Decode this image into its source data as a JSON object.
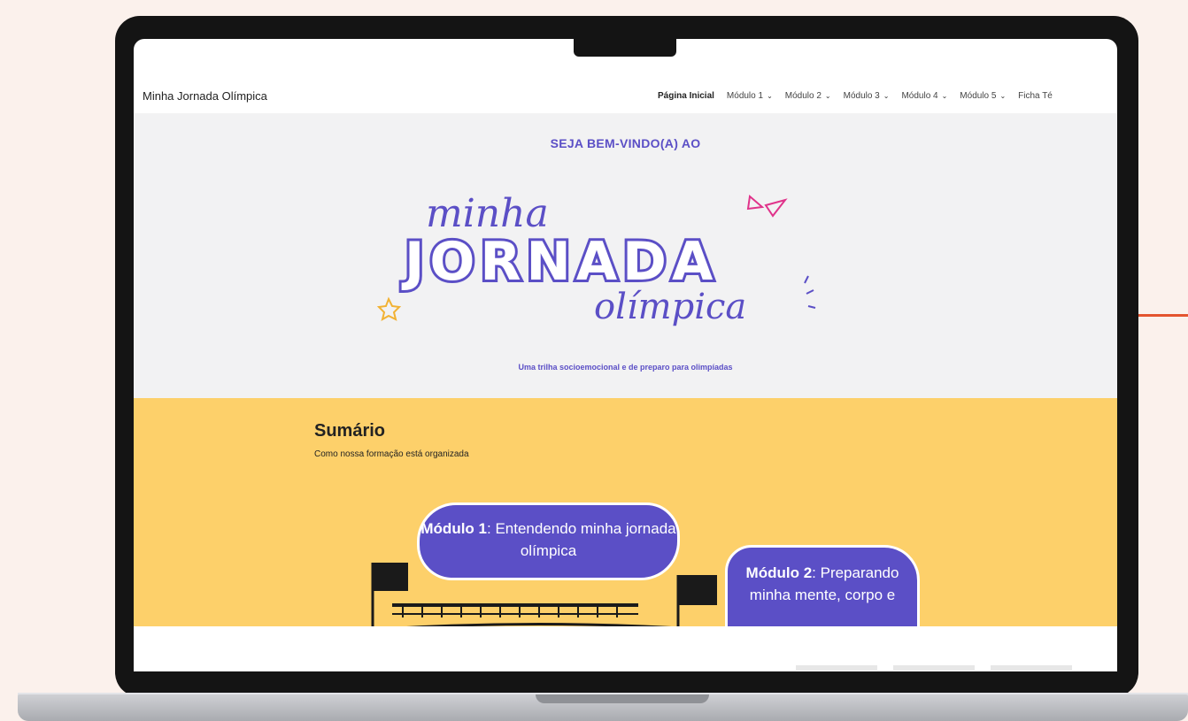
{
  "site": {
    "title": "Minha Jornada Olímpica"
  },
  "nav": {
    "items": [
      {
        "label": "Página Inicial",
        "active": true,
        "dropdown": false
      },
      {
        "label": "Módulo 1",
        "dropdown": true
      },
      {
        "label": "Módulo 2",
        "dropdown": true
      },
      {
        "label": "Módulo 3",
        "dropdown": true
      },
      {
        "label": "Módulo 4",
        "dropdown": true
      },
      {
        "label": "Módulo 5",
        "dropdown": true
      },
      {
        "label": "Ficha Té",
        "dropdown": false
      }
    ]
  },
  "hero": {
    "welcome": "SEJA BEM-VINDO(A) AO",
    "logo_top": "minha",
    "logo_main": "JORNADA",
    "logo_bottom": "olímpica",
    "tagline": "Uma trilha socioemocional e de preparo para olimpíadas"
  },
  "summary": {
    "title": "Sumário",
    "subtitle": "Como nossa formação está organizada",
    "module1": {
      "label": "Módulo 1",
      "text": ": Entendendo minha jornada olímpica"
    },
    "module2": {
      "label": "Módulo 2",
      "text": ": Preparando minha mente, corpo e"
    }
  },
  "colors": {
    "accent": "#5b4fc6",
    "summary_bg": "#fdd06a",
    "hero_bg": "#f2f2f3",
    "pink": "#e0338a",
    "line": "#e4542f"
  }
}
